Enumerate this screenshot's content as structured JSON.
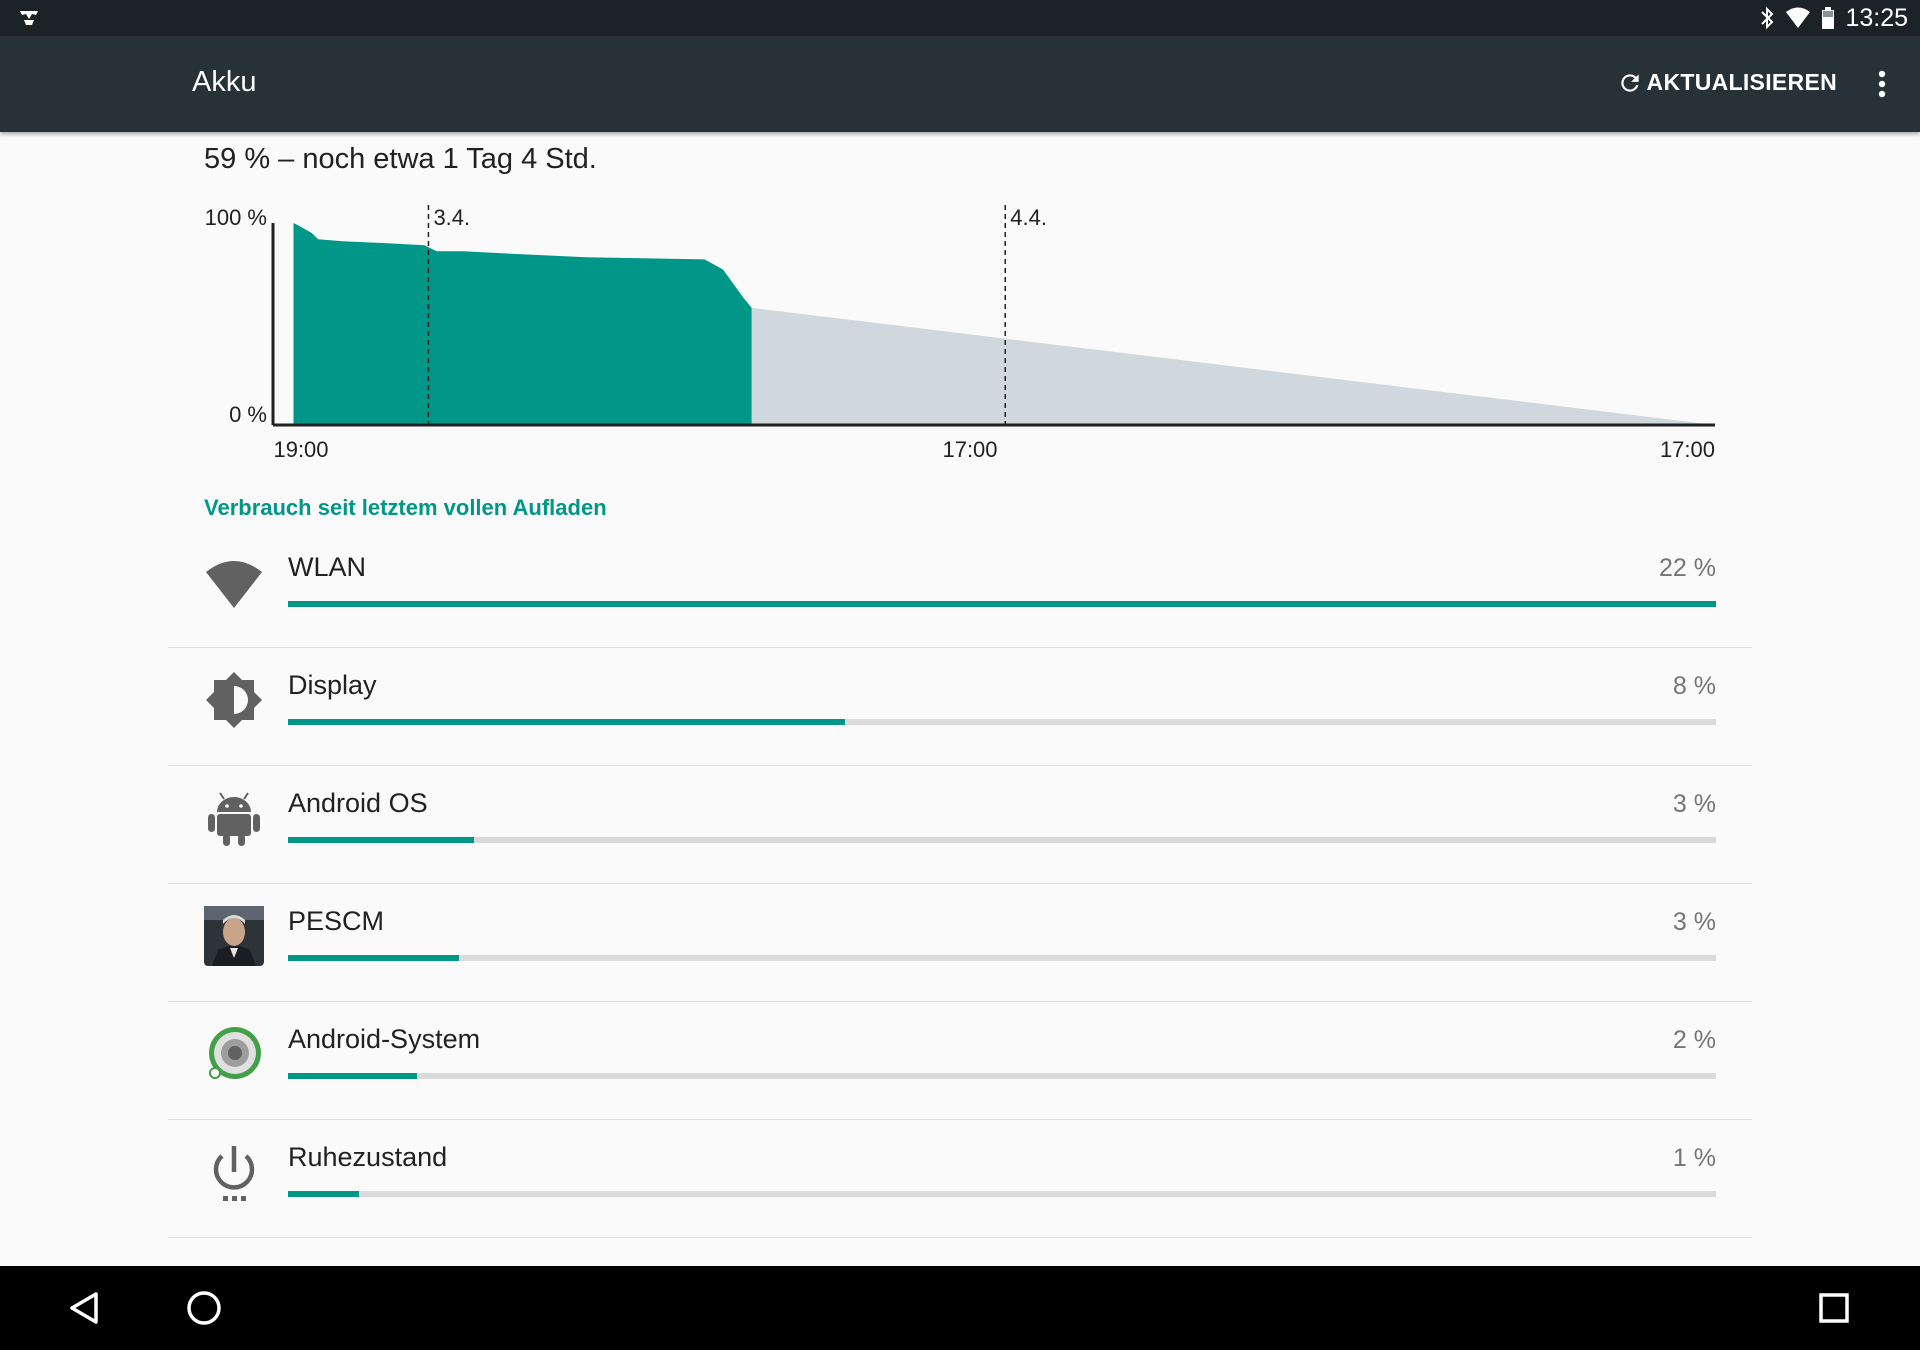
{
  "status_bar": {
    "time": "13:25",
    "icons": [
      "app-notification-icon",
      "bluetooth-icon",
      "wifi-icon",
      "battery-icon"
    ]
  },
  "app_bar": {
    "title": "Akku",
    "refresh_label": "AKTUALISIEREN",
    "refresh_icon": "refresh-icon",
    "overflow_icon": "more-vert-icon"
  },
  "summary": "59 % – noch etwa 1 Tag 4 Std.",
  "chart_data": {
    "type": "area",
    "y_ticks": [
      "100 %",
      "0 %"
    ],
    "x_ticks": [
      "19:00",
      "17:00",
      "17:00"
    ],
    "day_markers": [
      "3.4.",
      "4.4."
    ],
    "ylim": [
      0,
      100
    ],
    "x_unit": "hours since first tick (19:00)",
    "series": [
      {
        "values_x": [
          0,
          0.2,
          0.9,
          1.2,
          2.4,
          4.6,
          6.4,
          7.0,
          8.3,
          10.2,
          14.3,
          20.1,
          21.0,
          22.0,
          22.4
        ],
        "values_y": [
          100,
          99,
          95,
          92,
          91,
          90,
          89,
          86,
          86,
          85,
          83,
          82,
          77,
          63,
          58
        ],
        "color": "#009688"
      },
      {
        "values_x": [
          22.4,
          69.5
        ],
        "values_y": [
          58,
          0
        ],
        "color": "#cfd8dc"
      }
    ],
    "day_marker_x": [
      6.6,
      34.8
    ],
    "x_range": [
      -1,
      69.5
    ]
  },
  "section_header": "Verbrauch seit letztem vollen Aufladen",
  "usage": [
    {
      "label": "WLAN",
      "pct": "22 %",
      "fraction": 1.0,
      "icon": "wifi-icon"
    },
    {
      "label": "Display",
      "pct": "8 %",
      "fraction": 0.39,
      "icon": "brightness-icon"
    },
    {
      "label": "Android OS",
      "pct": "3 %",
      "fraction": 0.13,
      "icon": "android-icon"
    },
    {
      "label": "PESCM",
      "pct": "3 %",
      "fraction": 0.12,
      "icon": "pescm-app-icon"
    },
    {
      "label": "Android-System",
      "pct": "2 %",
      "fraction": 0.09,
      "icon": "android-system-icon"
    },
    {
      "label": "Ruhezustand",
      "pct": "1 %",
      "fraction": 0.05,
      "icon": "power-standby-icon"
    }
  ],
  "nav_bar": {
    "icons": [
      "back-icon",
      "home-icon",
      "recents-icon"
    ]
  }
}
